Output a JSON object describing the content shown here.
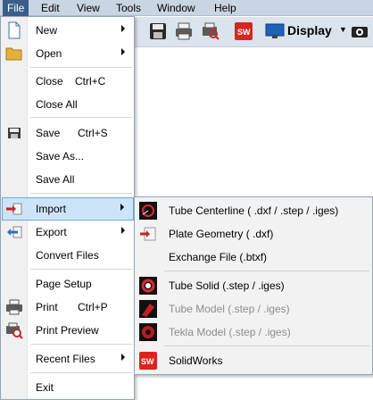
{
  "menubar": {
    "items": [
      "File",
      "Edit",
      "View",
      "Tools",
      "Window",
      "Help"
    ]
  },
  "toolbar": {
    "display_label": "Display"
  },
  "file_menu": {
    "new": "New",
    "open": "Open",
    "close": "Close",
    "close_shortcut": "Ctrl+C",
    "close_all": "Close All",
    "save": "Save",
    "save_shortcut": "Ctrl+S",
    "save_as": "Save As...",
    "save_all": "Save All",
    "import": "Import",
    "export": "Export",
    "convert_files": "Convert Files",
    "page_setup": "Page Setup",
    "print": "Print",
    "print_shortcut": "Ctrl+P",
    "print_preview": "Print Preview",
    "recent_files": "Recent Files",
    "exit": "Exit"
  },
  "import_submenu": {
    "tube_centerline": "Tube Centerline ( .dxf / .step / .iges)",
    "plate_geometry": "Plate Geometry ( .dxf)",
    "exchange_file": "Exchange File (.btxf)",
    "tube_solid": "Tube Solid (.step / .iges)",
    "tube_model": "Tube Model (.step / .iges)",
    "tekla_model": "Tekla Model (.step / .iges)",
    "solidworks": "SolidWorks"
  },
  "colors": {
    "highlight": "#cce4f7",
    "menubar_active": "#3a5e8c",
    "disabled_text": "#8d8d8d"
  }
}
